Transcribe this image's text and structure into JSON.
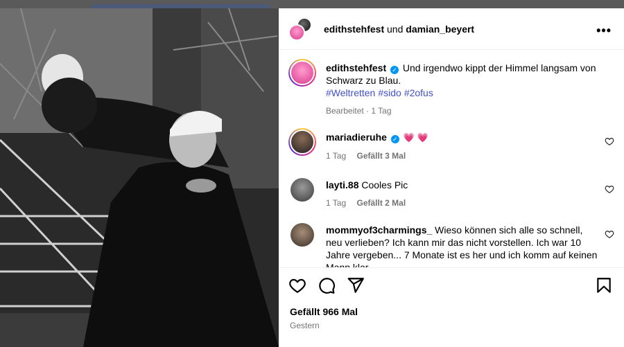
{
  "header": {
    "user1": "edithstehfest",
    "connector": "und",
    "user2": "damian_beyert",
    "more_icon": "more-horizontal-icon"
  },
  "caption": {
    "username": "edithstehfest",
    "text": "Und irgendwo kippt der Himmel langsam von Schwarz zu Blau.",
    "hashtags": [
      "#Weltretten",
      "#sido",
      "#2ofus"
    ],
    "edited": "Bearbeitet",
    "age": "1 Tag"
  },
  "comments": [
    {
      "username": "mariadieruhe",
      "verified": true,
      "text": "💗 💗",
      "age": "1 Tag",
      "likes": "Gefällt 3 Mal"
    },
    {
      "username": "layti.88",
      "verified": false,
      "text": "Cooles Pic",
      "age": "1 Tag",
      "likes": "Gefällt 2 Mal"
    },
    {
      "username": "mommyof3charmings_",
      "verified": false,
      "text": "Wieso können sich alle so schnell, neu verlieben? Ich kann mir das nicht vorstellen. Ich war 10 Jahre vergeben... 7 Monate ist es her und ich komm auf keinen Mann klar"
    }
  ],
  "actions": {
    "like_count": "Gefällt 966 Mal",
    "date": "Gestern"
  },
  "colors": {
    "verified": "#0095f6",
    "hashtag": "#4150c7",
    "heart": "#e0245e"
  }
}
